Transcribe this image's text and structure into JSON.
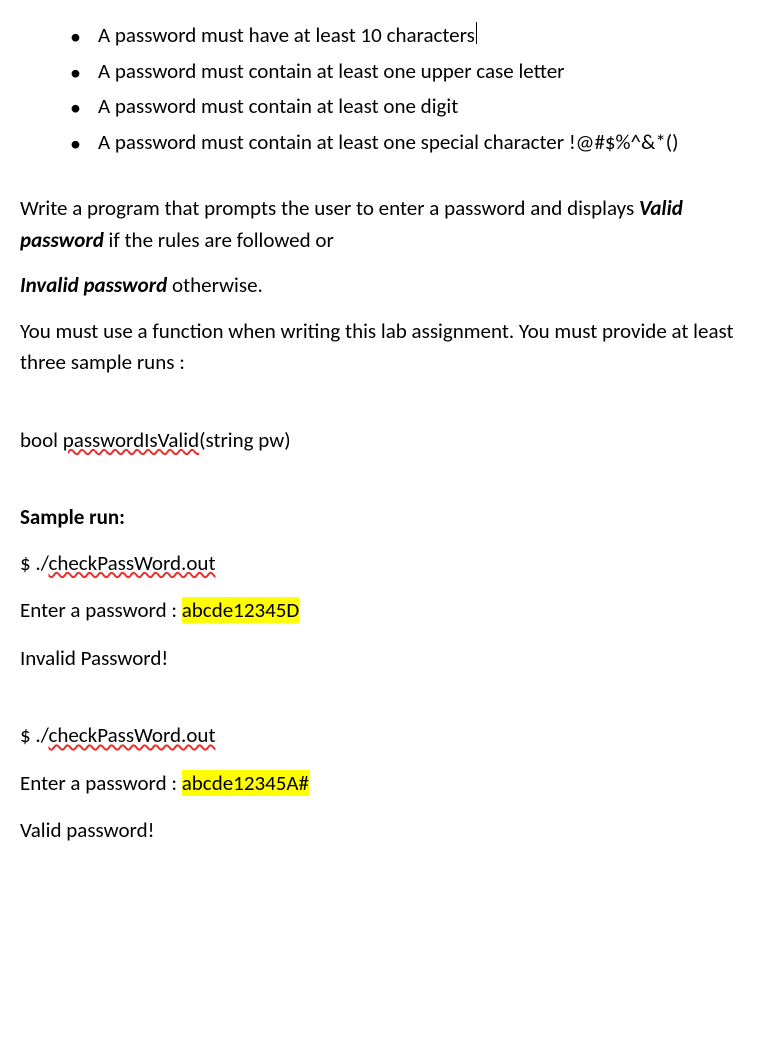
{
  "bullets": [
    {
      "text": "A password must have at least 10 characters",
      "cursor": true
    },
    {
      "text": "A password must contain at least one upper case letter",
      "cursor": false
    },
    {
      "text": "A password must contain at least one digit",
      "cursor": false
    },
    {
      "text": "A password must contain at least one special character !@#$%^&*()",
      "cursor": false
    }
  ],
  "intro": {
    "part1": "Write a program that prompts the user to enter a password and displays ",
    "valid": "Valid password",
    "part2": " if the rules are followed or",
    "invalid": " Invalid password",
    "part3": " otherwise.",
    "requirement": "You must use a function when writing this lab assignment. You must provide at least three sample runs :"
  },
  "func": {
    "bool": "bool   ",
    "name": "passwordIsValid",
    "args": "(string   pw)"
  },
  "sample": {
    "header": "Sample run:",
    "runs": [
      {
        "prompt_dollar": "$   ./",
        "cmd": "checkPassWord.out",
        "enter": "Enter a password  :  ",
        "input": "abcde12345D",
        "result": "Invalid Password!"
      },
      {
        "prompt_dollar": "$  ./",
        "cmd": "checkPassWord.out",
        "enter": "Enter a password  :  ",
        "input": "abcde12345A#",
        "result": "Valid password!"
      }
    ]
  }
}
